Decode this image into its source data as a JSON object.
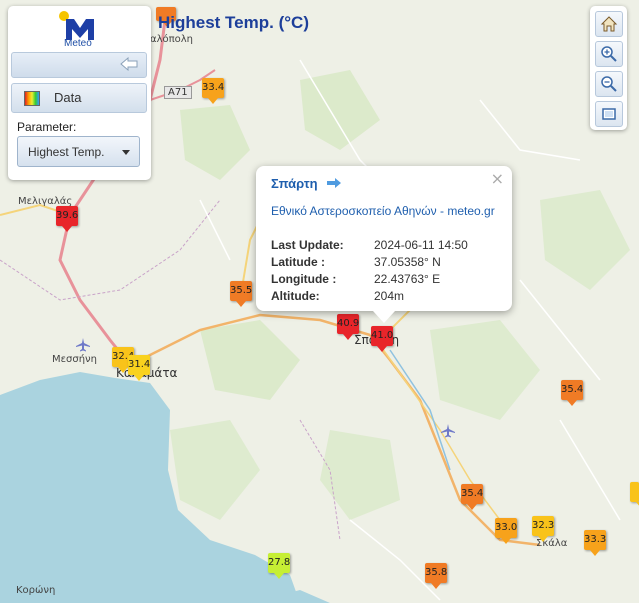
{
  "map_title": "Highest Temp. (°C)",
  "logo": {
    "text": "Meteo"
  },
  "panel": {
    "data_button_label": "Data",
    "parameter_label": "Parameter:",
    "parameter_value": "Highest Temp."
  },
  "popup": {
    "station": "Σπάρτη",
    "source": "Εθνικό Αστεροσκοπείο Αθηνών - meteo.gr",
    "fields": [
      {
        "label": "Last Update:",
        "value": "2024-06-11 14:50"
      },
      {
        "label": "Latitude :",
        "value": "37.05358° N"
      },
      {
        "label": "Longitude :",
        "value": "22.43763° E"
      },
      {
        "label": "Altitude:",
        "value": "204m"
      }
    ],
    "close": "×"
  },
  "places": {
    "megalopoli": "αλόπολη",
    "meligalas": "Μελιγαλάς",
    "messini": "Μεσσήνη",
    "kalamata": "Καλαμάτα",
    "sparti": "Σπάρτη",
    "skala": "Σκάλα",
    "koroni": "Κορώνη",
    "road": "A71"
  },
  "stations": [
    {
      "value": "39.6",
      "color": "#e8252a"
    },
    {
      "value": "33.4",
      "color": "#f7a21b"
    },
    {
      "value": "35.5",
      "color": "#f07b25"
    },
    {
      "value": "40.9",
      "color": "#e8252a"
    },
    {
      "value": "41.0",
      "color": "#e8252a"
    },
    {
      "value": "32.4",
      "color": "#f9c31a"
    },
    {
      "value": "31.4",
      "color": "#f9d21e"
    },
    {
      "value": "35.4",
      "color": "#f07b25"
    },
    {
      "value": "35.4",
      "color": "#f07b25"
    },
    {
      "value": "33.0",
      "color": "#f7a21b"
    },
    {
      "value": "32.3",
      "color": "#f9c31a"
    },
    {
      "value": "33.3",
      "color": "#f7a21b"
    },
    {
      "value": "27.8",
      "color": "#c6ef34"
    },
    {
      "value": "35.8",
      "color": "#f07b25"
    }
  ],
  "colors": {
    "sea": "#aad3df",
    "land": "#eef0e6",
    "title": "#1d3f9a",
    "link": "#1f5fae"
  }
}
